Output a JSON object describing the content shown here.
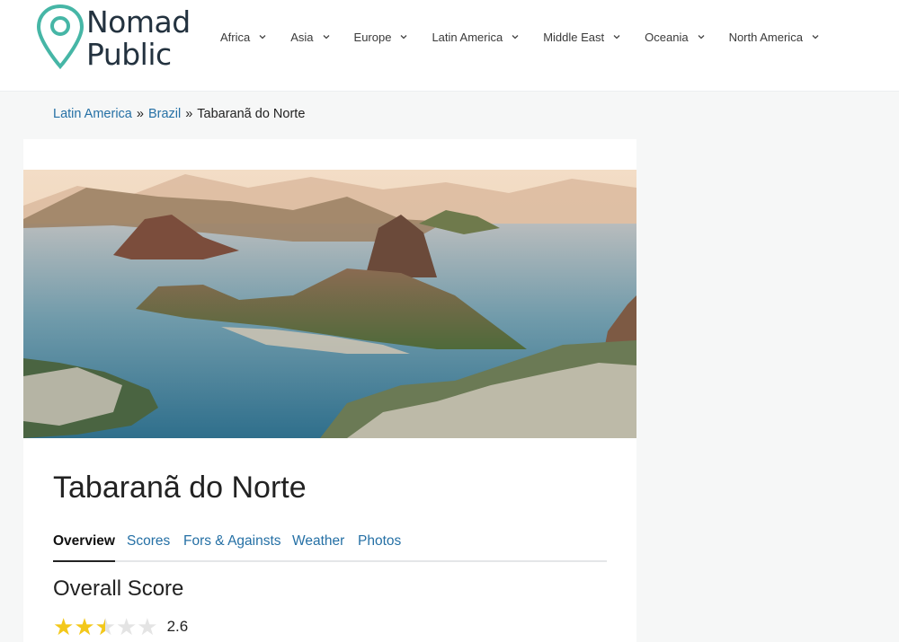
{
  "site": {
    "logo_text_line1": "Nomad",
    "logo_text_line2": "Public",
    "logo_color": "#46b6a6",
    "nav": [
      {
        "label": "Africa"
      },
      {
        "label": "Asia"
      },
      {
        "label": "Europe"
      },
      {
        "label": "Latin America"
      },
      {
        "label": "Middle East"
      },
      {
        "label": "Oceania"
      },
      {
        "label": "North America"
      }
    ]
  },
  "breadcrumb": {
    "items": [
      "Latin America",
      "Brazil",
      "Tabaranã do Norte"
    ],
    "separator": "»"
  },
  "place": {
    "title": "Tabaranã do Norte"
  },
  "tabs": [
    {
      "label": "Overview",
      "active": true
    },
    {
      "label": "Scores",
      "active": false
    },
    {
      "label": "Fors & Againsts",
      "active": false
    },
    {
      "label": "Weather",
      "active": false
    },
    {
      "label": "Photos",
      "active": false
    }
  ],
  "overview": {
    "section_title": "Overall Score",
    "score": "2.6",
    "stars_filled_fraction": 0.52
  },
  "colors": {
    "link": "#2570a5",
    "star": "#f3c81a",
    "background": "#f6f7f7"
  }
}
